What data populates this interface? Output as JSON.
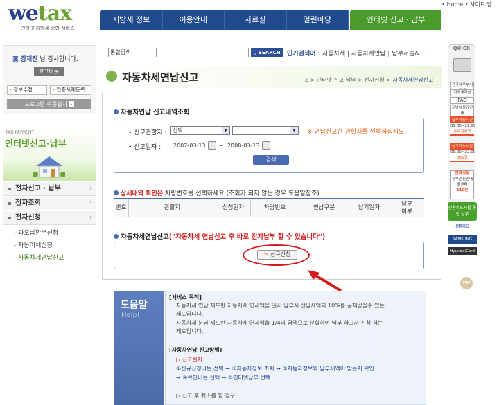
{
  "header": {
    "logo_main": "we",
    "logo_e": "tax",
    "logo_tagline": "인터넷 지방세 종합 서비스",
    "toplinks": "• Home  • 사이트 맵",
    "gnb": [
      "지방세 정보",
      "이용안내",
      "자료실",
      "열린마당"
    ],
    "gnb_highlight": "인터넷 신고 · 납부"
  },
  "search": {
    "select": "통합검색",
    "button": "SEARCH",
    "popular_label": "인기검색어 :",
    "popular_items": "자동차세 | 자동차세연납 | 납부서출&..."
  },
  "left": {
    "user_name": "강재진",
    "user_greeting": " 님 감사합니다.",
    "logout": "로그아웃",
    "info_edit": "정보수정",
    "cert_register": "인증서재등록",
    "program_install": "프로그램 수동설치",
    "banner_small": "TAX PAYMENT",
    "banner_title": "인터넷신고·납부",
    "menus": [
      "전자신고 · 납부",
      "전자조회",
      "전자신청"
    ],
    "submenus": [
      "과오납환부신청",
      "자동이체신청",
      "자동차세연납신고"
    ]
  },
  "main": {
    "title": "자동차세연납신고",
    "breadcrumb": [
      "인터넷 신고 납부",
      "전자신청"
    ],
    "breadcrumb_current": "자동차세연납신고",
    "sec1_title": "자동차연납 신고내역조회",
    "label_office": "신고관할지 :",
    "select_office": "선택",
    "select_office2": "",
    "notice": "※ 연납신고한 관할지를 선택하십시오.",
    "label_date": "신고일자 :",
    "date_from": "2007-03-13",
    "date_sep": "~",
    "date_to": "2008-03-13",
    "search_btn": "검색",
    "help_red": "상세내역 확인은",
    "help_rest": " 차량번호를 선택하세요.(조회가 되지 않는 경우 도움말참조)",
    "table_headers": [
      "번호",
      "관할지",
      "신청일자",
      "차량번호",
      "연납구분",
      "납기일자",
      "납부 여부"
    ],
    "sec3_title": "자동차세연납신고",
    "sec3_red": "(\"자동차세 연납신고 후 바로 전자납부 할 수 있습니다\")",
    "apply_btn": "신규신청"
  },
  "help": {
    "title_kr": "도움말",
    "title_en": "Help!",
    "lines": [
      "[서비스 목적]",
      "자동차세 연납 제도란 자동차세 연세액을 일시 납부시 선납세액의 10%를 공제받을수 있는",
      "제도입니다.",
      "자동차세 분납 제도란 자동차세 연세액을 1/4의 금액으로 분할하여 납부 하고자 신청 하는",
      "제도입니다.",
      "[자동차연납 신고방법]",
      "▷ 신고절차",
      "①신규신청버튼 선택 → ②자동차정보 조회 → ③자동차정보와 납부세액이 맞는지 확인",
      "→ ④확인버튼 선택 → ⑤인터넷납부 선택",
      "▷ 신고 후 취소를 할 경우"
    ]
  },
  "quick": {
    "title": "QUICK",
    "links": [
      "전국세무부서안내",
      "지방세계산",
      "FAQ",
      "지방세상담안내"
    ],
    "box1": [
      "납부가능시간",
      "09:00~22:00",
      "휴무일제외"
    ],
    "box2": [
      "신고가능시간",
      "09:00~22:00",
      "365일"
    ],
    "counsel": [
      "전화상담",
      "정부민원안내",
      "콜센터",
      "110번"
    ],
    "card_sale": "신용카드사를 통한 납부",
    "banks": [
      "신한카드",
      "SAMSUNG CARD",
      "HyundaiCard"
    ],
    "top": "TOP"
  }
}
